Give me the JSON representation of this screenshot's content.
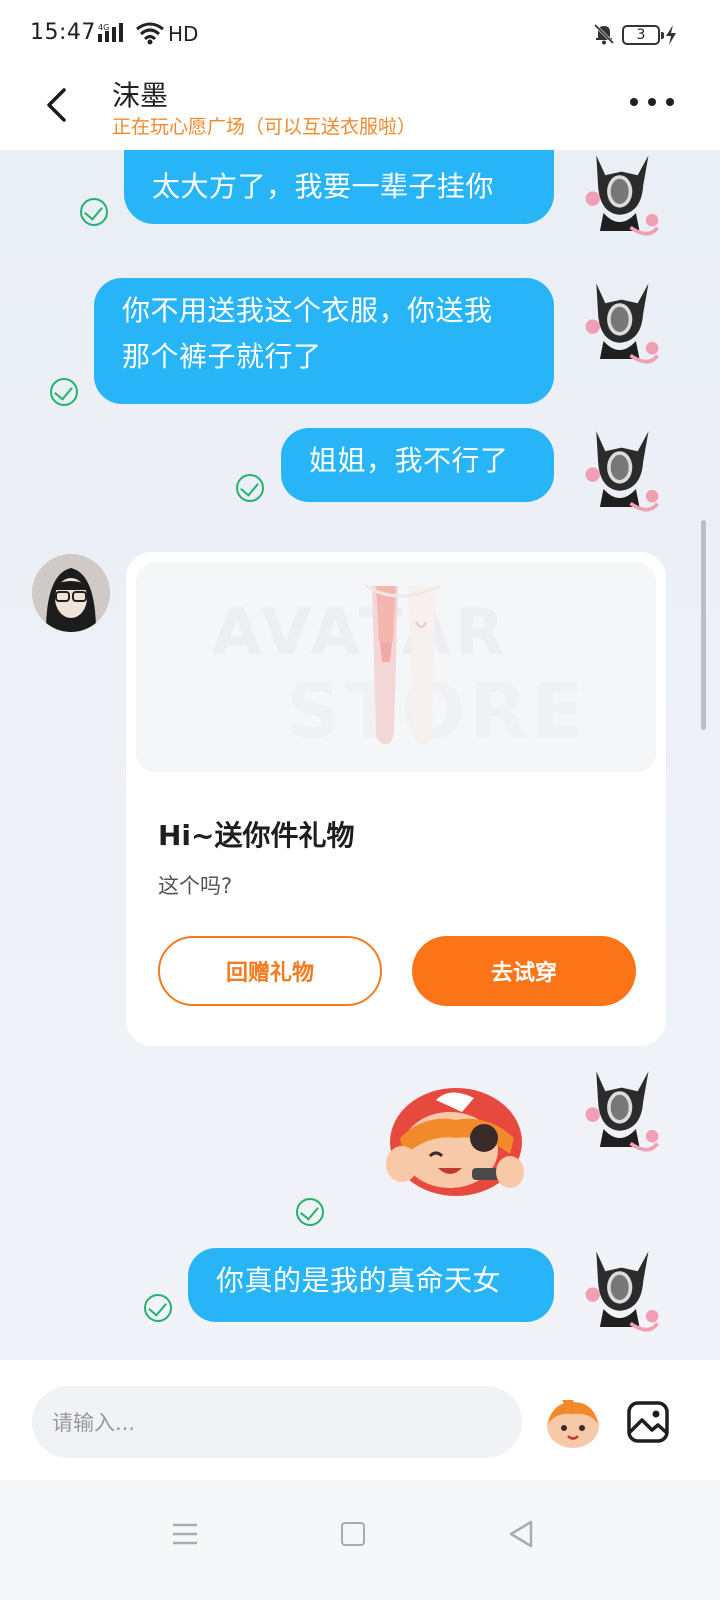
{
  "status_bar": {
    "time": "15:47",
    "network": "4G",
    "hd_label": "HD",
    "battery": "3"
  },
  "header": {
    "contact_name": "沫墨",
    "contact_status": "正在玩心愿广场（可以互送衣服啦）"
  },
  "messages": [
    {
      "sender": "me",
      "text": "太大方了，我要一辈子挂你",
      "read": true
    },
    {
      "sender": "me",
      "text": "你不用送我这个衣服，你送我那个裤子就行了",
      "line1": "你不用送我这个衣服，你送我",
      "line2": "那个裤子就行了",
      "read": true
    },
    {
      "sender": "me",
      "text": "姐姐，我不行了",
      "read": true
    }
  ],
  "gift_card": {
    "watermark_top": "AVATAR",
    "watermark_bottom": "STORE",
    "title": "Hi~送你件礼物",
    "message": "这个吗?",
    "return_button": "回赠礼物",
    "try_on_button": "去试穿"
  },
  "last_message": {
    "sender": "me",
    "text": "你真的是我的真命天女",
    "read": true
  },
  "input": {
    "placeholder": "请输入..."
  },
  "colors": {
    "bubble": "#27b5f7",
    "accent_orange": "#fb7418",
    "status_orange": "#f08a2b",
    "read_green": "#23b26d"
  }
}
